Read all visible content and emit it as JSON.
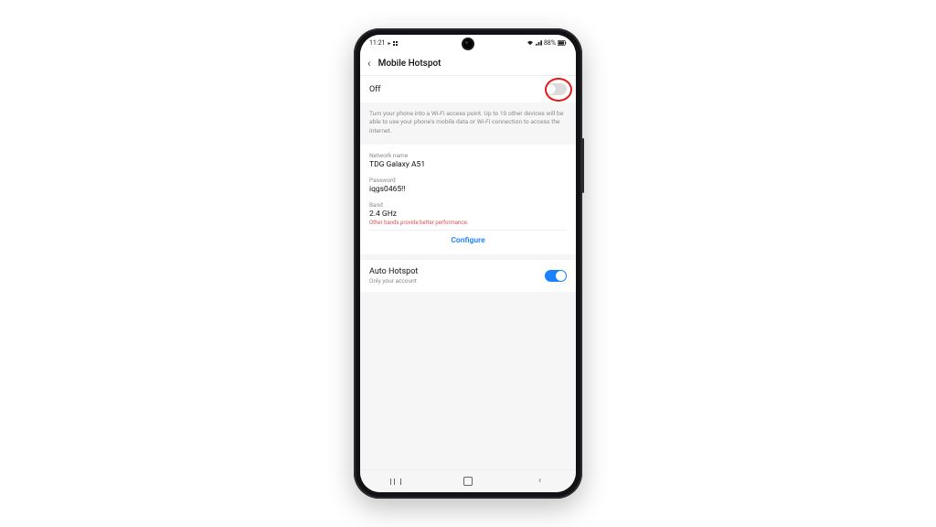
{
  "statusbar": {
    "time": "11:21",
    "battery_text": "88%"
  },
  "header": {
    "title": "Mobile Hotspot"
  },
  "hotspot_toggle": {
    "state_label": "Off",
    "on": false
  },
  "info_text": "Turn your phone into a Wi-Fi access point. Up to 10 other devices will be able to use your phone's mobile data or Wi-Fi connection to access the internet.",
  "fields": {
    "network_name": {
      "label": "Network name",
      "value": "TDG Galaxy A51"
    },
    "password": {
      "label": "Password",
      "value": "iqgs0465!!"
    },
    "band": {
      "label": "Band",
      "value": "2.4 GHz",
      "warning": "Other bands provide better performance."
    }
  },
  "configure_label": "Configure",
  "auto_hotspot": {
    "title": "Auto Hotspot",
    "subtitle": "Only your account",
    "on": true
  },
  "colors": {
    "accent": "#1a82ff",
    "warn": "#d9534f",
    "annotation": "#e41b1b"
  }
}
